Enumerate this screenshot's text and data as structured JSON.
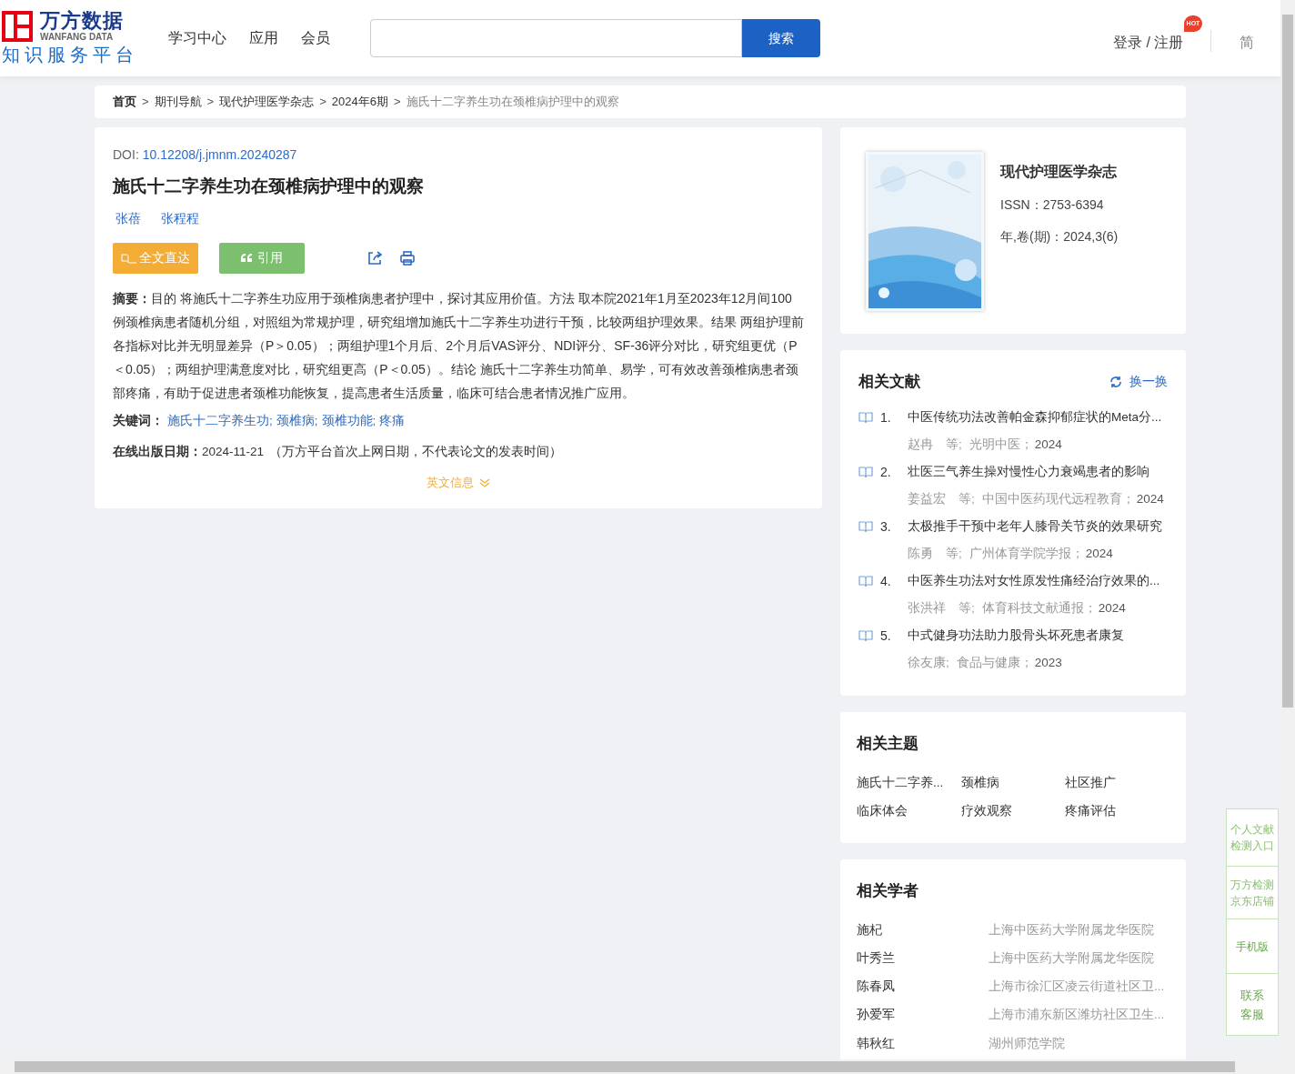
{
  "header": {
    "logo": {
      "title": "万方数据",
      "subtitle": "WANFANG DATA",
      "slogan": "知识服务平台"
    },
    "nav": [
      "学习中心",
      "应用",
      "会员"
    ],
    "search": {
      "button": "搜索"
    },
    "login": "登录 / 注册",
    "hot_badge": "HOT",
    "language": {
      "label": "简",
      "selected": true
    }
  },
  "breadcrumb": [
    {
      "label": "首页",
      "kind": "home"
    },
    {
      "label": ">",
      "kind": "separator"
    },
    {
      "label": "期刊导航",
      "kind": "link"
    },
    {
      "label": ">",
      "kind": "separator"
    },
    {
      "label": "现代护理医学杂志",
      "kind": "link"
    },
    {
      "label": ">",
      "kind": "separator"
    },
    {
      "label": "2024年6期",
      "kind": "link"
    },
    {
      "label": ">",
      "kind": "separator"
    },
    {
      "label": "施氏十二字养生功在颈椎病护理中的观察",
      "kind": "current"
    }
  ],
  "article": {
    "doi_label": "DOI:",
    "doi": "10.12208/j.jmnm.20240287",
    "title": "施氏十二字养生功在颈椎病护理中的观察",
    "authors": [
      "张蓓",
      "张程程"
    ],
    "full_text_button": "全文直达",
    "cite_button": "引用",
    "abstract": "**摘要：**目的 将施氏十二字养生功应用于颈椎病患者护理中，探讨其应用价值。方法 取本院2021年1月至2023年12月间100例颈椎病患者随机分组，对照组为常规护理，研究组增加施氏十二字养生功进行干预，比较两组护理效果。结果 两组护理前各指标对比并无明显差异（P＞0.05）；两组护理1个月后、2个月后VAS评分、NDI评分、SF-36评分对比，研究组更优（P＜0.05）；两组护理满意度对比，研究组更高（P＜0.05）。结论 施氏十二字养生功简单、易学，可有效改善颈椎病患者颈部疼痛，有助于促进患者颈椎功能恢复，提高患者生活质量，临床可结合患者情况推广应用。",
    "keywords_label": "关键词：",
    "keywords": [
      "施氏十二字养生功;",
      "颈椎病;",
      "颈椎功能;",
      "疼痛"
    ],
    "date_label": "在线出版日期：",
    "date": "2024-11-21",
    "date_note": "（万方平台首次上网日期，不代表论文的发表时间）",
    "english_toggle": "英文信息"
  },
  "journal": {
    "name": "现代护理医学杂志",
    "issn": "ISSN：2753-6394",
    "volume": "年,卷(期)：2024,3(6)"
  },
  "related_docs": {
    "title": "相关文献",
    "refresh": "换一换",
    "items": [
      {
        "number": "1.",
        "title": "中医传统功法改善帕金森抑郁症状的Meta分...",
        "authors": "赵冉　等;",
        "source": "光明中医；",
        "year": "2024"
      },
      {
        "number": "2.",
        "title": "壮医三气养生操对慢性心力衰竭患者的影响",
        "authors": "姜益宏　等;",
        "source": "中国中医药现代远程教育；",
        "year": "2024"
      },
      {
        "number": "3.",
        "title": "太极推手干预中老年人膝骨关节炎的效果研究",
        "authors": "陈勇　等;",
        "source": "广州体育学院学报；",
        "year": "2024"
      },
      {
        "number": "4.",
        "title": "中医养生功法对女性原发性痛经治疗效果的...",
        "authors": "张洪祥　等;",
        "source": "体育科技文献通报；",
        "year": "2024"
      },
      {
        "number": "5.",
        "title": "中式健身功法助力股骨头坏死患者康复",
        "authors": "徐友康;",
        "source": "食品与健康；",
        "year": "2023"
      }
    ]
  },
  "related_topics": {
    "title": "相关主题",
    "items": [
      "施氏十二字养...",
      "颈椎病",
      "社区推广",
      "临床体会",
      "疗效观察",
      "疼痛评估"
    ]
  },
  "related_scholars": {
    "title": "相关学者",
    "items": [
      {
        "name": "施杞",
        "org": "上海中医药大学附属龙华医院"
      },
      {
        "name": "叶秀兰",
        "org": "上海中医药大学附属龙华医院"
      },
      {
        "name": "陈春凤",
        "org": "上海市徐汇区凌云街道社区卫..."
      },
      {
        "name": "孙爱军",
        "org": "上海市浦东新区潍坊社区卫生..."
      },
      {
        "name": "韩秋红",
        "org": "湖州师范学院"
      }
    ]
  },
  "float_bar": [
    {
      "lines": [
        "个人文献",
        "检测入口"
      ]
    },
    {
      "lines": [
        "万方检测",
        "京东店铺"
      ]
    },
    {
      "lines": [
        "手机版"
      ]
    },
    {
      "lines": [
        "联系",
        "客服"
      ]
    }
  ]
}
